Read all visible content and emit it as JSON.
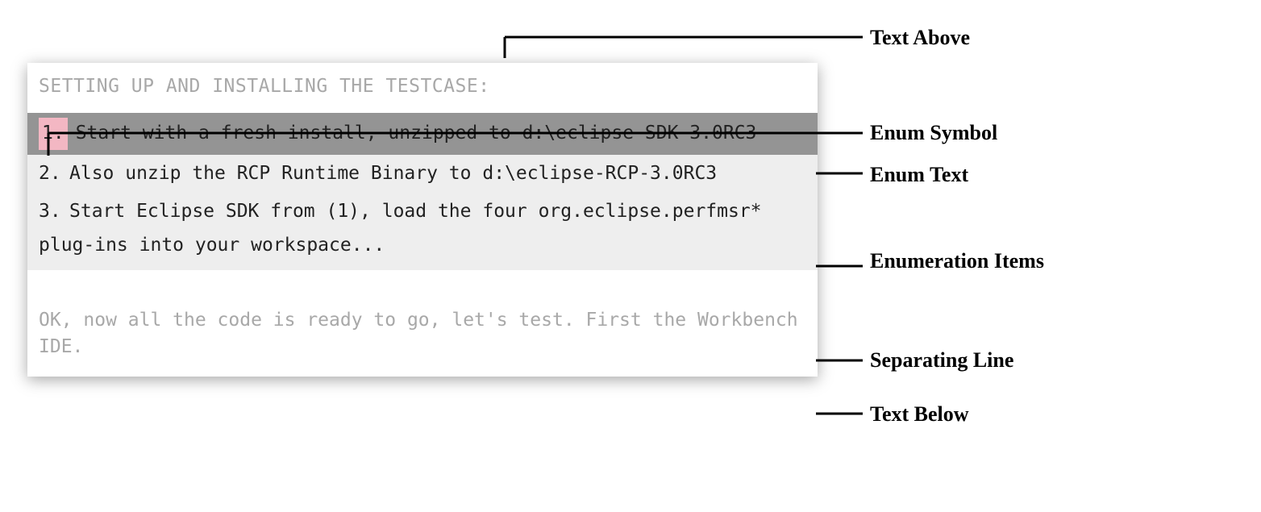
{
  "heading": "SETTING UP AND INSTALLING THE TESTCASE:",
  "items": [
    {
      "sym": "1.",
      "text": "Start with a fresh install, unzipped to d:\\eclipse-SDK-3.0RC3"
    },
    {
      "sym": "2.",
      "text": "Also unzip the RCP Runtime Binary to d:\\eclipse-RCP-3.0RC3"
    },
    {
      "sym": "3.",
      "text": "Start Eclipse SDK from (1), load the four org.eclipse.perfmsr*"
    }
  ],
  "wrap": "plug-ins into your workspace...",
  "below": "OK, now all the code is ready to go, let's test.  First the Workbench IDE.",
  "labels": {
    "textAbove": "Text Above",
    "enumSymbol": "Enum Symbol",
    "enumText": "Enum Text",
    "enumItems": "Enumeration Items",
    "sepLine": "Separating Line",
    "textBelow": "Text Below"
  }
}
